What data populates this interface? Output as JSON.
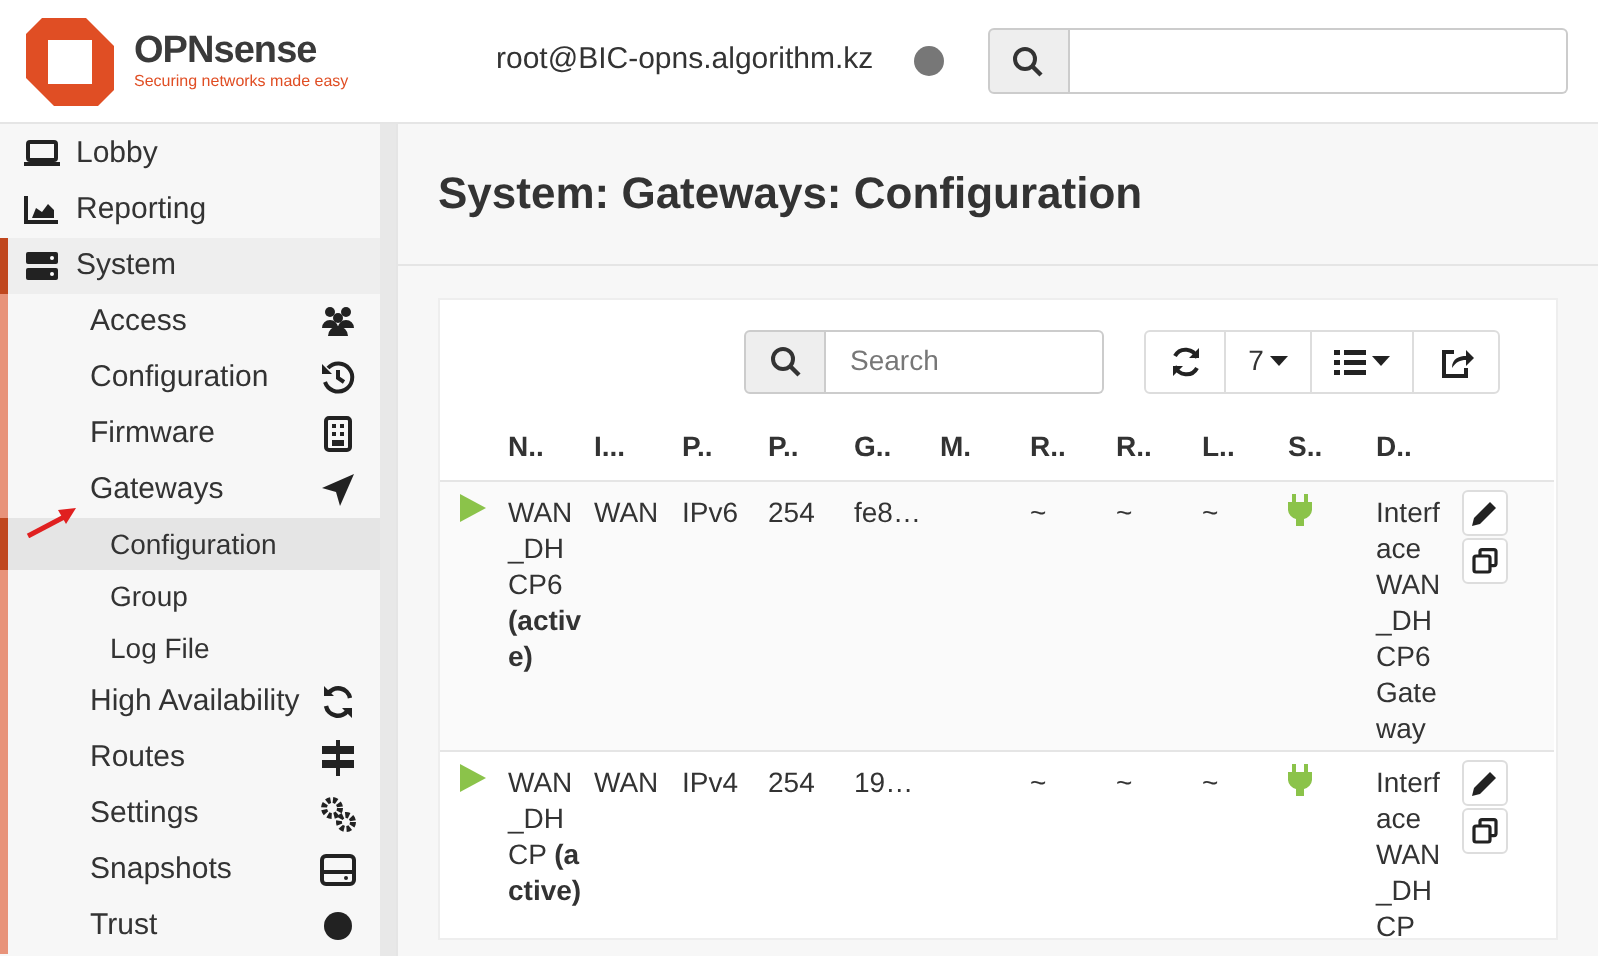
{
  "header": {
    "logo": {
      "name": "OPNsense",
      "tagline": "Securing networks made easy"
    },
    "user": "root@BIC-opns.algorithm.kz"
  },
  "sidebar": {
    "items": [
      {
        "label": "Lobby"
      },
      {
        "label": "Reporting"
      },
      {
        "label": "System",
        "expanded": true,
        "children": [
          {
            "label": "Access"
          },
          {
            "label": "Configuration"
          },
          {
            "label": "Firmware"
          },
          {
            "label": "Gateways",
            "expanded": true,
            "children": [
              {
                "label": "Configuration",
                "selected": true
              },
              {
                "label": "Group",
                "selected": false
              },
              {
                "label": "Log File",
                "selected": false
              }
            ]
          },
          {
            "label": "High Availability"
          },
          {
            "label": "Routes"
          },
          {
            "label": "Settings"
          },
          {
            "label": "Snapshots"
          },
          {
            "label": "Trust"
          }
        ]
      }
    ]
  },
  "page_title": "System: Gateways: Configuration",
  "grid": {
    "search": {
      "placeholder": "Search"
    },
    "page_size": "7",
    "columns": [
      "N..",
      "I...",
      "P..",
      "P..",
      "G..",
      "M.",
      "R..",
      "R..",
      "L..",
      "S..",
      "D.."
    ],
    "rows": [
      {
        "enabled": true,
        "online": true,
        "cells": [
          "WAN_DHCP6 **(active)**",
          "WAN",
          "IPv6",
          "254",
          "fe8…",
          "",
          "~",
          "~",
          "~",
          "",
          "Interface WAN_DHCP6 Gateway"
        ]
      },
      {
        "enabled": true,
        "online": true,
        "cells": [
          "WAN_DHCP **(active)**",
          "WAN",
          "IPv4",
          "254",
          "19…",
          "",
          "~",
          "~",
          "~",
          "",
          "Interface WAN_DHCP"
        ]
      }
    ]
  }
}
